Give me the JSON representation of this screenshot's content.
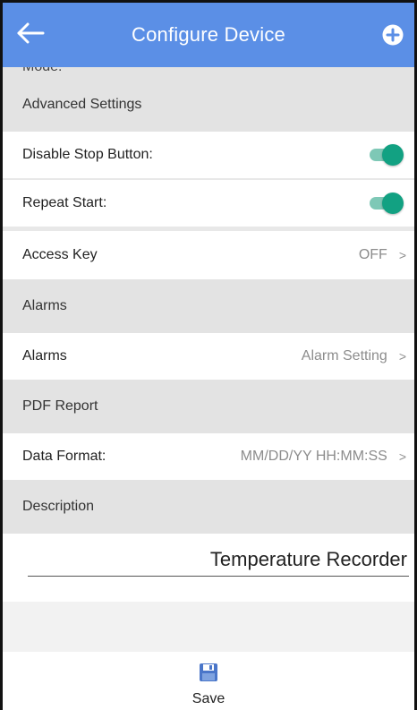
{
  "appbar": {
    "title": "Configure Device",
    "back_icon": "arrow-left-icon",
    "add_icon": "plus-circle-icon",
    "background_color": "#5b8fe6"
  },
  "cutoff_label": "Mode:",
  "sections": {
    "advanced": {
      "header": "Advanced Settings",
      "disable_stop_label": "Disable Stop Button:",
      "disable_stop_enabled": true,
      "repeat_start_label": "Repeat Start:",
      "repeat_start_enabled": true,
      "access_key_label": "Access Key",
      "access_key_value": "OFF"
    },
    "alarms": {
      "header": "Alarms",
      "item_label": "Alarms",
      "item_value": "Alarm Setting"
    },
    "pdf": {
      "header": "PDF Report",
      "data_format_label": "Data Format:",
      "data_format_value": "MM/DD/YY HH:MM:SS"
    },
    "description": {
      "header": "Description",
      "value": "Temperature Recorder"
    }
  },
  "chevron": ">",
  "toggle_color": "#12a182",
  "bottom": {
    "save_label": "Save",
    "save_icon": "floppy-disk-icon"
  }
}
